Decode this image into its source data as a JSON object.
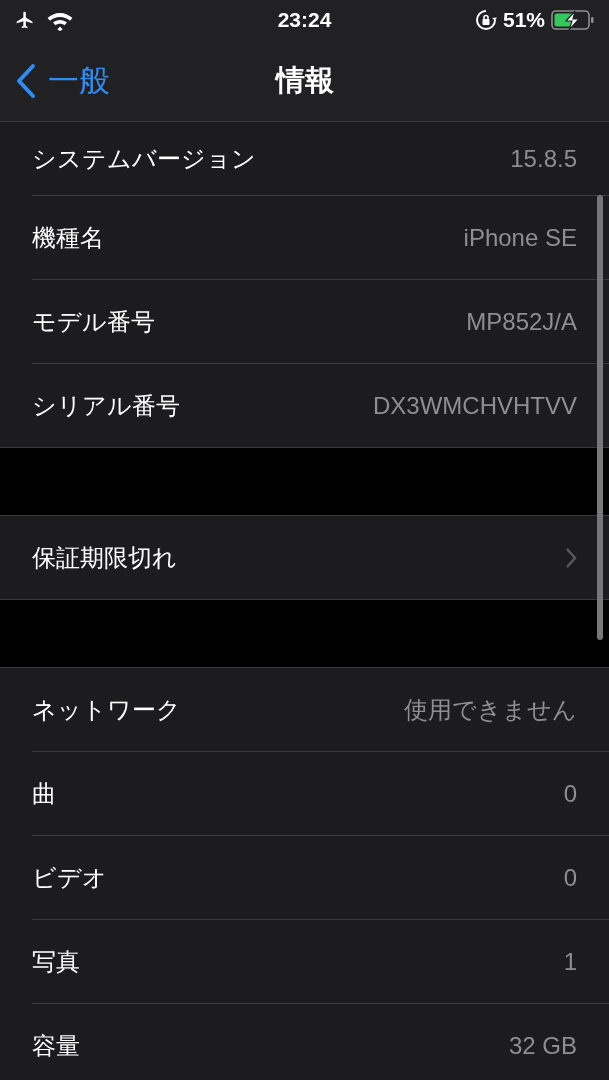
{
  "status_bar": {
    "time": "23:24",
    "battery_percent": "51%"
  },
  "nav": {
    "back": "一般",
    "title": "情報"
  },
  "sections": [
    {
      "rows": [
        {
          "kind": "value",
          "label": "システムバージョン",
          "value": "15.8.5",
          "clipped": true
        },
        {
          "kind": "value",
          "label": "機種名",
          "value": "iPhone SE"
        },
        {
          "kind": "value",
          "label": "モデル番号",
          "value": "MP852J/A"
        },
        {
          "kind": "value",
          "label": "シリアル番号",
          "value": "DX3WMCHVHTVV"
        }
      ]
    },
    {
      "rows": [
        {
          "kind": "link",
          "label": "保証期限切れ"
        }
      ]
    },
    {
      "rows": [
        {
          "kind": "value",
          "label": "ネットワーク",
          "value": "使用できません"
        },
        {
          "kind": "value",
          "label": "曲",
          "value": "0"
        },
        {
          "kind": "value",
          "label": "ビデオ",
          "value": "0"
        },
        {
          "kind": "value",
          "label": "写真",
          "value": "1"
        },
        {
          "kind": "value",
          "label": "容量",
          "value": "32 GB"
        }
      ]
    }
  ]
}
